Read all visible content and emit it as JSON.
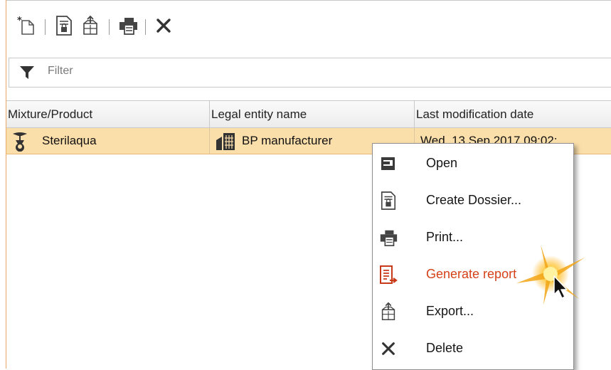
{
  "toolbar": {
    "buttons": [
      {
        "name": "new-icon"
      },
      {
        "name": "create-dossier-icon"
      },
      {
        "name": "export-icon"
      },
      {
        "name": "print-icon"
      },
      {
        "name": "delete-icon"
      }
    ]
  },
  "filter": {
    "placeholder": "Filter"
  },
  "table": {
    "columns": [
      "Mixture/Product",
      "Legal entity name",
      "Last modification date"
    ],
    "rows": [
      {
        "product": "Sterilaqua",
        "legal_entity": "BP manufacturer",
        "date": "Wed, 13 Sep 2017 09:02:..."
      }
    ],
    "selected_row_color": "#fbdfab"
  },
  "context_menu": {
    "items": [
      {
        "label": "Open",
        "icon": "open-icon"
      },
      {
        "label": "Create Dossier...",
        "icon": "create-dossier-icon"
      },
      {
        "label": "Print...",
        "icon": "print-icon"
      },
      {
        "label": "Generate report",
        "icon": "generate-report-icon",
        "active": true
      },
      {
        "label": "Export...",
        "icon": "export-icon"
      },
      {
        "label": "Delete",
        "icon": "delete-icon"
      }
    ],
    "active_color": "#d4421a"
  }
}
